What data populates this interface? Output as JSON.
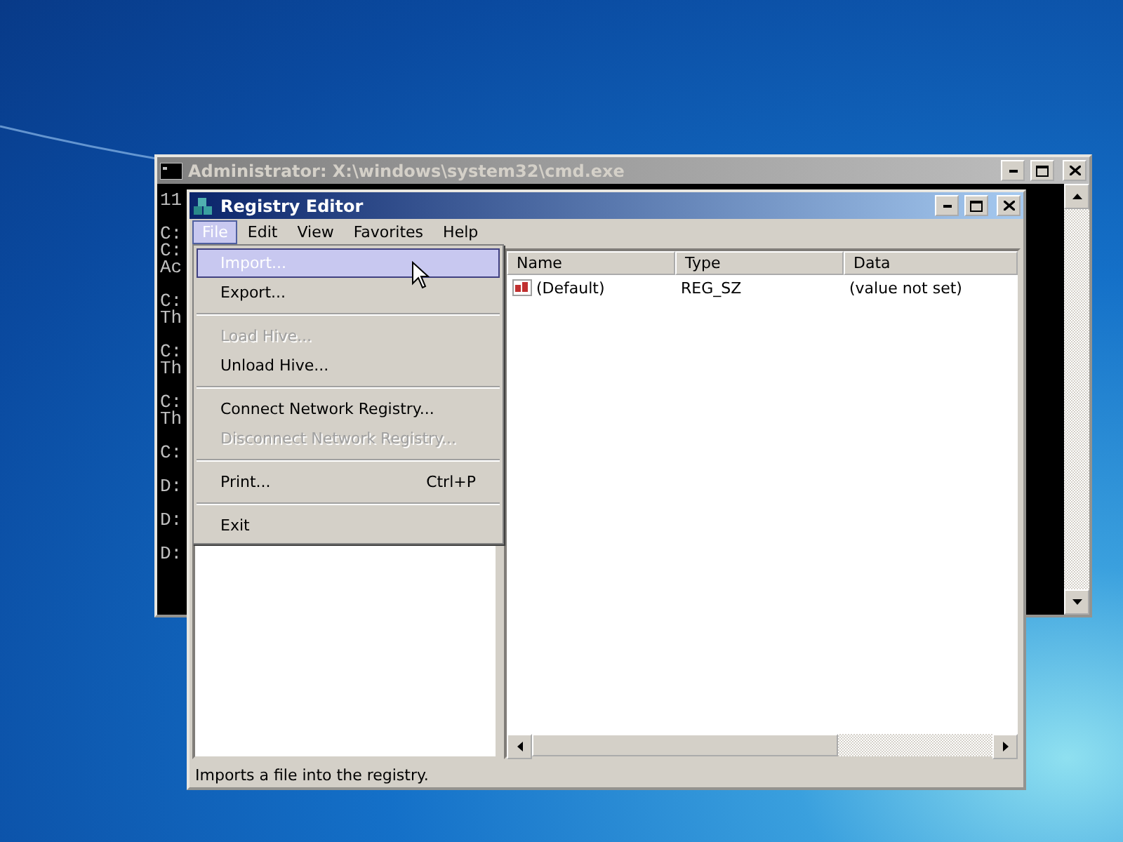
{
  "console_window": {
    "title": "Administrator: X:\\windows\\system32\\cmd.exe",
    "active": false,
    "blocks": [
      [
        "11"
      ],
      [
        "C:",
        "C:",
        "Ac"
      ],
      [
        "C:",
        "Th"
      ],
      [
        "C:",
        "Th"
      ],
      [
        "C:",
        "Th"
      ],
      [
        "C:"
      ],
      [
        "D:"
      ],
      [
        "D:"
      ],
      [
        "D:"
      ]
    ]
  },
  "registry_window": {
    "title": "Registry Editor",
    "active": true,
    "menu_bar": [
      {
        "label": "File",
        "selected": true
      },
      {
        "label": "Edit",
        "selected": false
      },
      {
        "label": "View",
        "selected": false
      },
      {
        "label": "Favorites",
        "selected": false
      },
      {
        "label": "Help",
        "selected": false
      }
    ],
    "file_menu": [
      {
        "kind": "item",
        "label": "Import...",
        "selected": true,
        "disabled": false
      },
      {
        "kind": "item",
        "label": "Export...",
        "selected": false,
        "disabled": false
      },
      {
        "kind": "separator"
      },
      {
        "kind": "item",
        "label": "Load Hive...",
        "selected": false,
        "disabled": true
      },
      {
        "kind": "item",
        "label": "Unload Hive...",
        "selected": false,
        "disabled": false
      },
      {
        "kind": "separator"
      },
      {
        "kind": "item",
        "label": "Connect Network Registry...",
        "selected": false,
        "disabled": false
      },
      {
        "kind": "item",
        "label": "Disconnect Network Registry...",
        "selected": false,
        "disabled": true
      },
      {
        "kind": "separator"
      },
      {
        "kind": "item",
        "label": "Print...",
        "shortcut": "Ctrl+P",
        "selected": false,
        "disabled": false
      },
      {
        "kind": "separator"
      },
      {
        "kind": "item",
        "label": "Exit",
        "selected": false,
        "disabled": false
      }
    ],
    "values_table": {
      "columns": [
        "Name",
        "Type",
        "Data"
      ],
      "rows": [
        {
          "name": "(Default)",
          "type": "REG_SZ",
          "data": "(value not set)"
        }
      ]
    },
    "status_bar": "Imports a file into the registry."
  }
}
